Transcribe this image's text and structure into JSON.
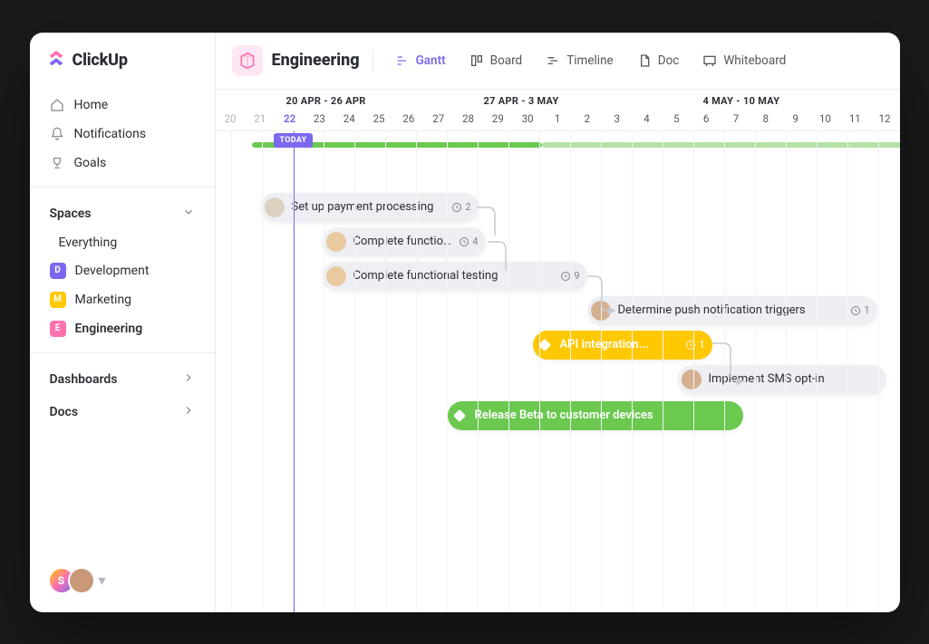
{
  "brand": "ClickUp",
  "nav": {
    "home": "Home",
    "notifications": "Notifications",
    "goals": "Goals"
  },
  "sections": {
    "spaces_label": "Spaces",
    "everything_label": "Everything",
    "dashboards": "Dashboards",
    "docs": "Docs"
  },
  "spaces": [
    {
      "label": "Development",
      "initial": "D",
      "color": "#7b68ee"
    },
    {
      "label": "Marketing",
      "initial": "M",
      "color": "#ffc800"
    },
    {
      "label": "Engineering",
      "initial": "E",
      "color": "#fd71af"
    }
  ],
  "header": {
    "space_name": "Engineering",
    "views": {
      "gantt": "Gantt",
      "board": "Board",
      "timeline": "Timeline",
      "doc": "Doc",
      "whiteboard": "Whiteboard"
    }
  },
  "calendar": {
    "week1": "20 APR - 26 APR",
    "week2": "27 APR - 3 MAY",
    "week3": "4 MAY - 10 MAY",
    "today_label": "TODAY",
    "days": [
      "20",
      "21",
      "22",
      "23",
      "24",
      "25",
      "26",
      "27",
      "28",
      "29",
      "30",
      "1",
      "2",
      "3",
      "4",
      "5",
      "6",
      "7",
      "8",
      "9",
      "10",
      "11",
      "12"
    ]
  },
  "tasks": {
    "t1": {
      "label": "Set up payment processing",
      "count": "2"
    },
    "t2": {
      "label": "Complete functio...",
      "count": "4"
    },
    "t3": {
      "label": "Complete functional testing",
      "count": "9"
    },
    "t4": {
      "label": "Determine push notification triggers",
      "count": "1"
    },
    "t5": {
      "label": "API integration...",
      "count": "1"
    },
    "t6": {
      "label": "Implement SMS opt-in"
    },
    "t7": {
      "label": "Release Beta to customer devices"
    }
  },
  "users": {
    "initial": "S"
  },
  "colors": {
    "purple": "#7b68ee",
    "yellow": "#ffc800",
    "pink": "#fd71af",
    "green": "#6bc950"
  }
}
